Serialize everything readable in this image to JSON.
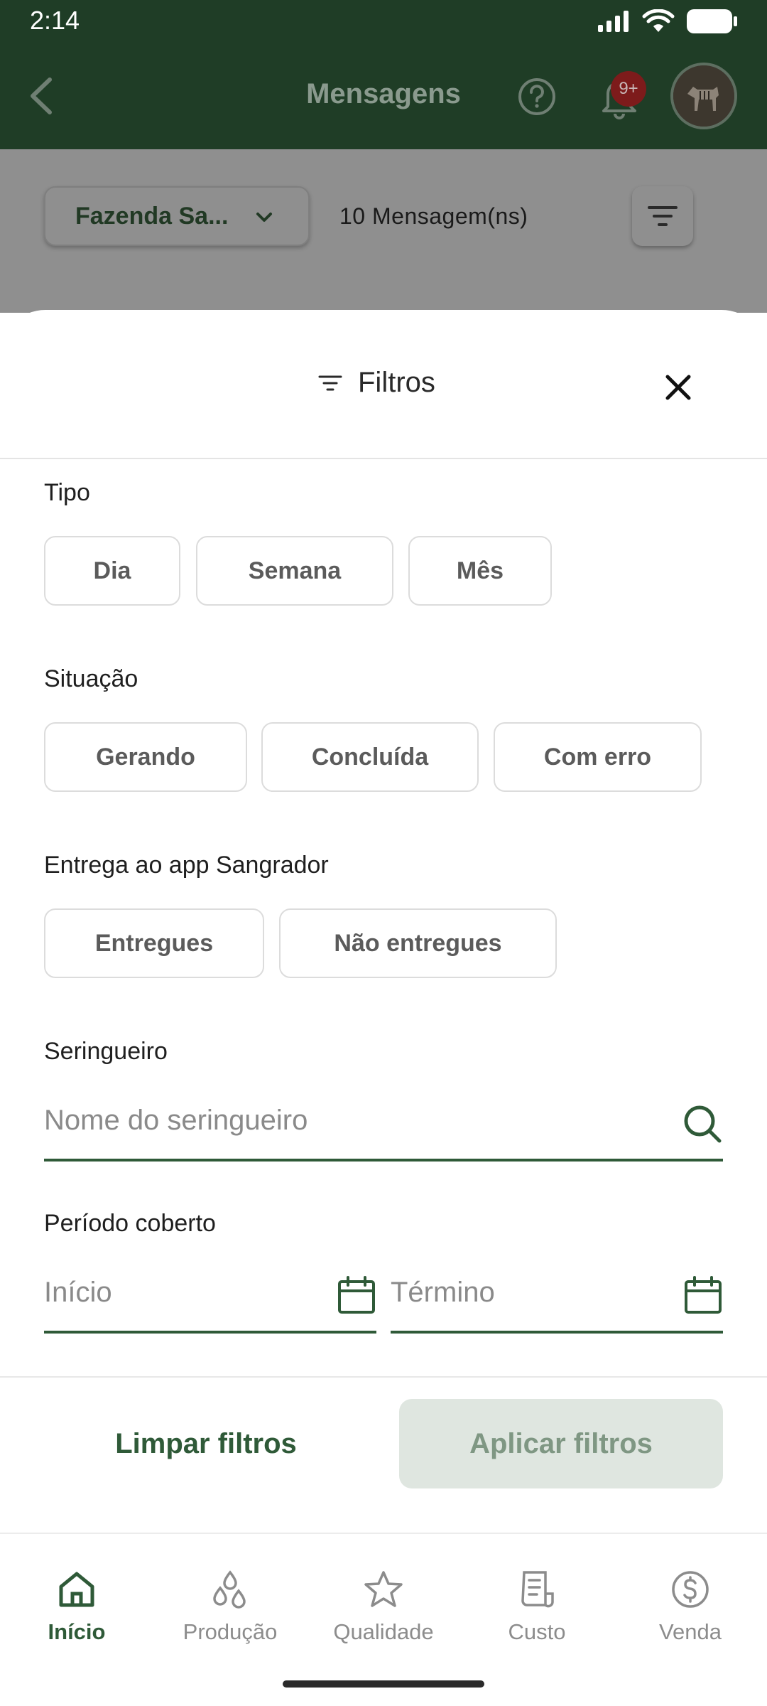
{
  "status_bar": {
    "time": "2:14"
  },
  "app_bar": {
    "title": "Mensagens",
    "notification_badge": "9+"
  },
  "toolbar": {
    "farm_selector": "Fazenda Sa...",
    "message_count": "10 Mensagem(ns)"
  },
  "filter_sheet": {
    "title": "Filtros",
    "tipo": {
      "label": "Tipo",
      "options": [
        "Dia",
        "Semana",
        "Mês"
      ]
    },
    "situacao": {
      "label": "Situação",
      "options": [
        "Gerando",
        "Concluída",
        "Com erro"
      ]
    },
    "entrega": {
      "label": "Entrega ao app Sangrador",
      "options": [
        "Entregues",
        "Não entregues"
      ]
    },
    "seringueiro": {
      "label": "Seringueiro",
      "placeholder": "Nome do seringueiro"
    },
    "periodo": {
      "label": "Período coberto",
      "start_placeholder": "Início",
      "end_placeholder": "Término"
    },
    "clear_label": "Limpar filtros",
    "apply_label": "Aplicar filtros"
  },
  "bottom_nav": {
    "items": [
      {
        "label": "Início",
        "icon": "home-icon",
        "active": true
      },
      {
        "label": "Produção",
        "icon": "drops-icon"
      },
      {
        "label": "Qualidade",
        "icon": "star-icon"
      },
      {
        "label": "Custo",
        "icon": "receipt-icon"
      },
      {
        "label": "Venda",
        "icon": "dollar-icon"
      }
    ]
  },
  "colors": {
    "primary": "#2f5a38",
    "app_bar": "#1f3d26",
    "overlay": "#8f8f8f",
    "badge": "#7d1b1b"
  }
}
